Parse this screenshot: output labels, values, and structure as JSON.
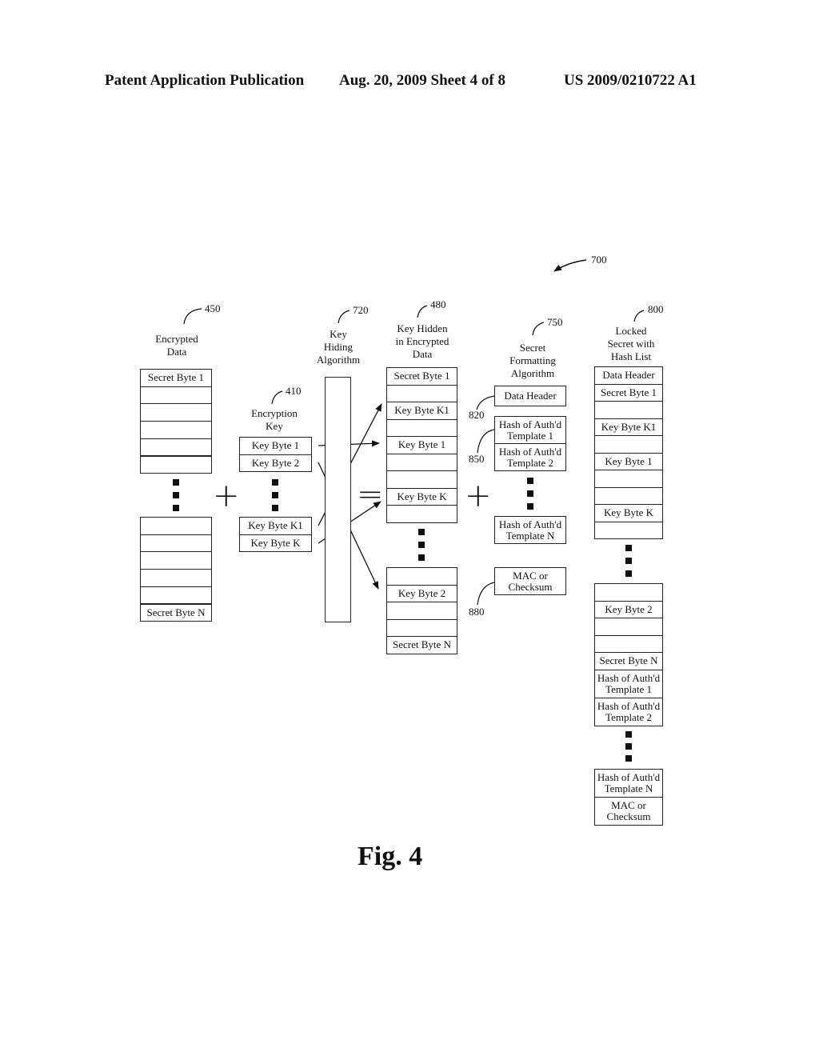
{
  "header": {
    "publication": "Patent Application Publication",
    "date_sheet": "Aug. 20, 2009   Sheet 4 of 8",
    "number": "US 2009/0210722 A1"
  },
  "refs": {
    "r700": "700",
    "r450": "450",
    "r410": "410",
    "r720": "720",
    "r480": "480",
    "r750": "750",
    "r800": "800",
    "r820": "820",
    "r850": "850",
    "r880": "880"
  },
  "labels": {
    "encrypted_data": [
      "Encrypted",
      "Data"
    ],
    "encryption_key": [
      "Encryption",
      "Key"
    ],
    "key_hiding": [
      "Key",
      "Hiding",
      "Algorithm"
    ],
    "key_hidden": [
      "Key Hidden",
      "in Encrypted",
      "Data"
    ],
    "secret_formatting": [
      "Secret",
      "Formatting",
      "Algorithm"
    ],
    "locked_secret": [
      "Locked",
      "Secret with",
      "Hash List"
    ]
  },
  "operators": {
    "plus": "+",
    "equals": "="
  },
  "encrypted_data_cells": {
    "top": [
      "Secret Byte 1",
      "",
      "",
      "",
      "",
      ""
    ],
    "bottom": [
      "",
      "",
      "",
      "",
      "",
      "Secret Byte N"
    ]
  },
  "encryption_key_cells": {
    "top": [
      "Key Byte 1",
      "Key Byte 2"
    ],
    "bottom": [
      "Key Byte K1",
      "Key Byte K"
    ]
  },
  "key_hidden_cells": {
    "top": [
      "Secret Byte 1",
      "",
      "Key Byte K1",
      "",
      "Key Byte 1",
      "",
      "",
      "Key Byte K",
      ""
    ],
    "bottom": [
      "",
      "Key Byte 2",
      "",
      "",
      "Secret Byte N"
    ]
  },
  "formatting_cells": {
    "data_header": "Data Header",
    "hash1": [
      "Hash of Auth'd",
      "Template 1"
    ],
    "hash2": [
      "Hash of Auth'd",
      "Template 2"
    ],
    "hashN": [
      "Hash of Auth'd",
      "Template N"
    ],
    "mac": [
      "MAC or",
      "Checksum"
    ]
  },
  "locked_cells": {
    "top": [
      "Data Header",
      "Secret Byte 1",
      "",
      "Key Byte K1",
      "",
      "Key Byte 1",
      "",
      "",
      "Key Byte K",
      ""
    ],
    "middle": [
      "",
      "Key Byte 2",
      "",
      "",
      "Secret Byte N",
      "Hash of Auth'd\nTemplate 1",
      "Hash of Auth'd\nTemplate 2"
    ],
    "bottom": [
      "Hash of Auth'd\nTemplate N",
      "MAC or\nChecksum"
    ]
  },
  "figure_caption": "Fig. 4"
}
